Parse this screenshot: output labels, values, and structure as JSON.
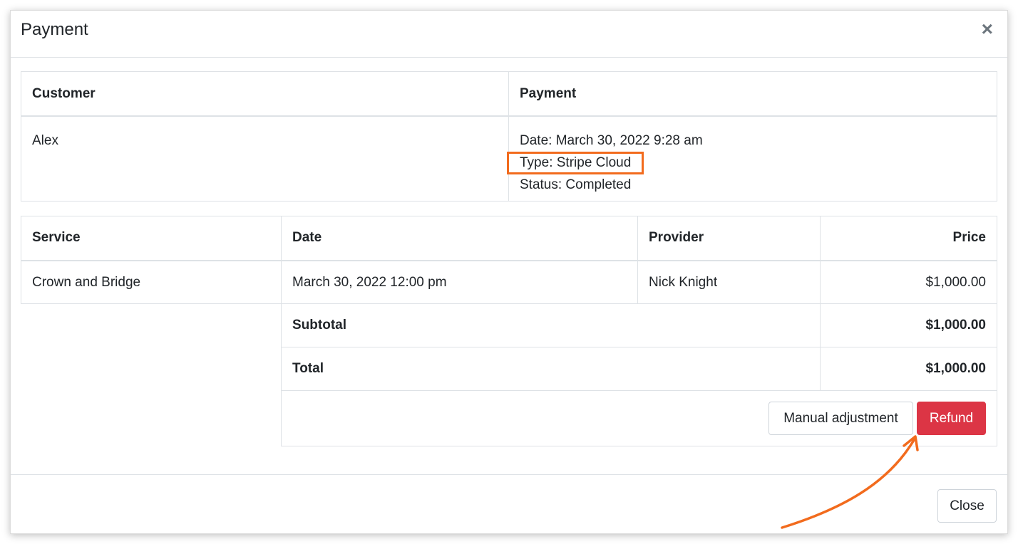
{
  "modal": {
    "title": "Payment",
    "close_icon": "close-icon"
  },
  "info": {
    "headers": [
      "Customer",
      "Payment"
    ],
    "customer": "Alex",
    "payment_date": "Date: March 30, 2022 9:28 am",
    "payment_type": "Type: Stripe Cloud",
    "payment_status": "Status: Completed"
  },
  "services": {
    "headers": [
      "Service",
      "Date",
      "Provider",
      "Price"
    ],
    "rows": [
      {
        "service": "Crown and Bridge",
        "date": "March 30, 2022 12:00 pm",
        "provider": "Nick Knight",
        "price": "$1,000.00"
      }
    ],
    "subtotal_label": "Subtotal",
    "subtotal_value": "$1,000.00",
    "total_label": "Total",
    "total_value": "$1,000.00"
  },
  "buttons": {
    "manual_adjustment": "Manual adjustment",
    "refund": "Refund",
    "close": "Close"
  },
  "colors": {
    "highlight": "#f26b1d",
    "refund": "#dc3545"
  }
}
